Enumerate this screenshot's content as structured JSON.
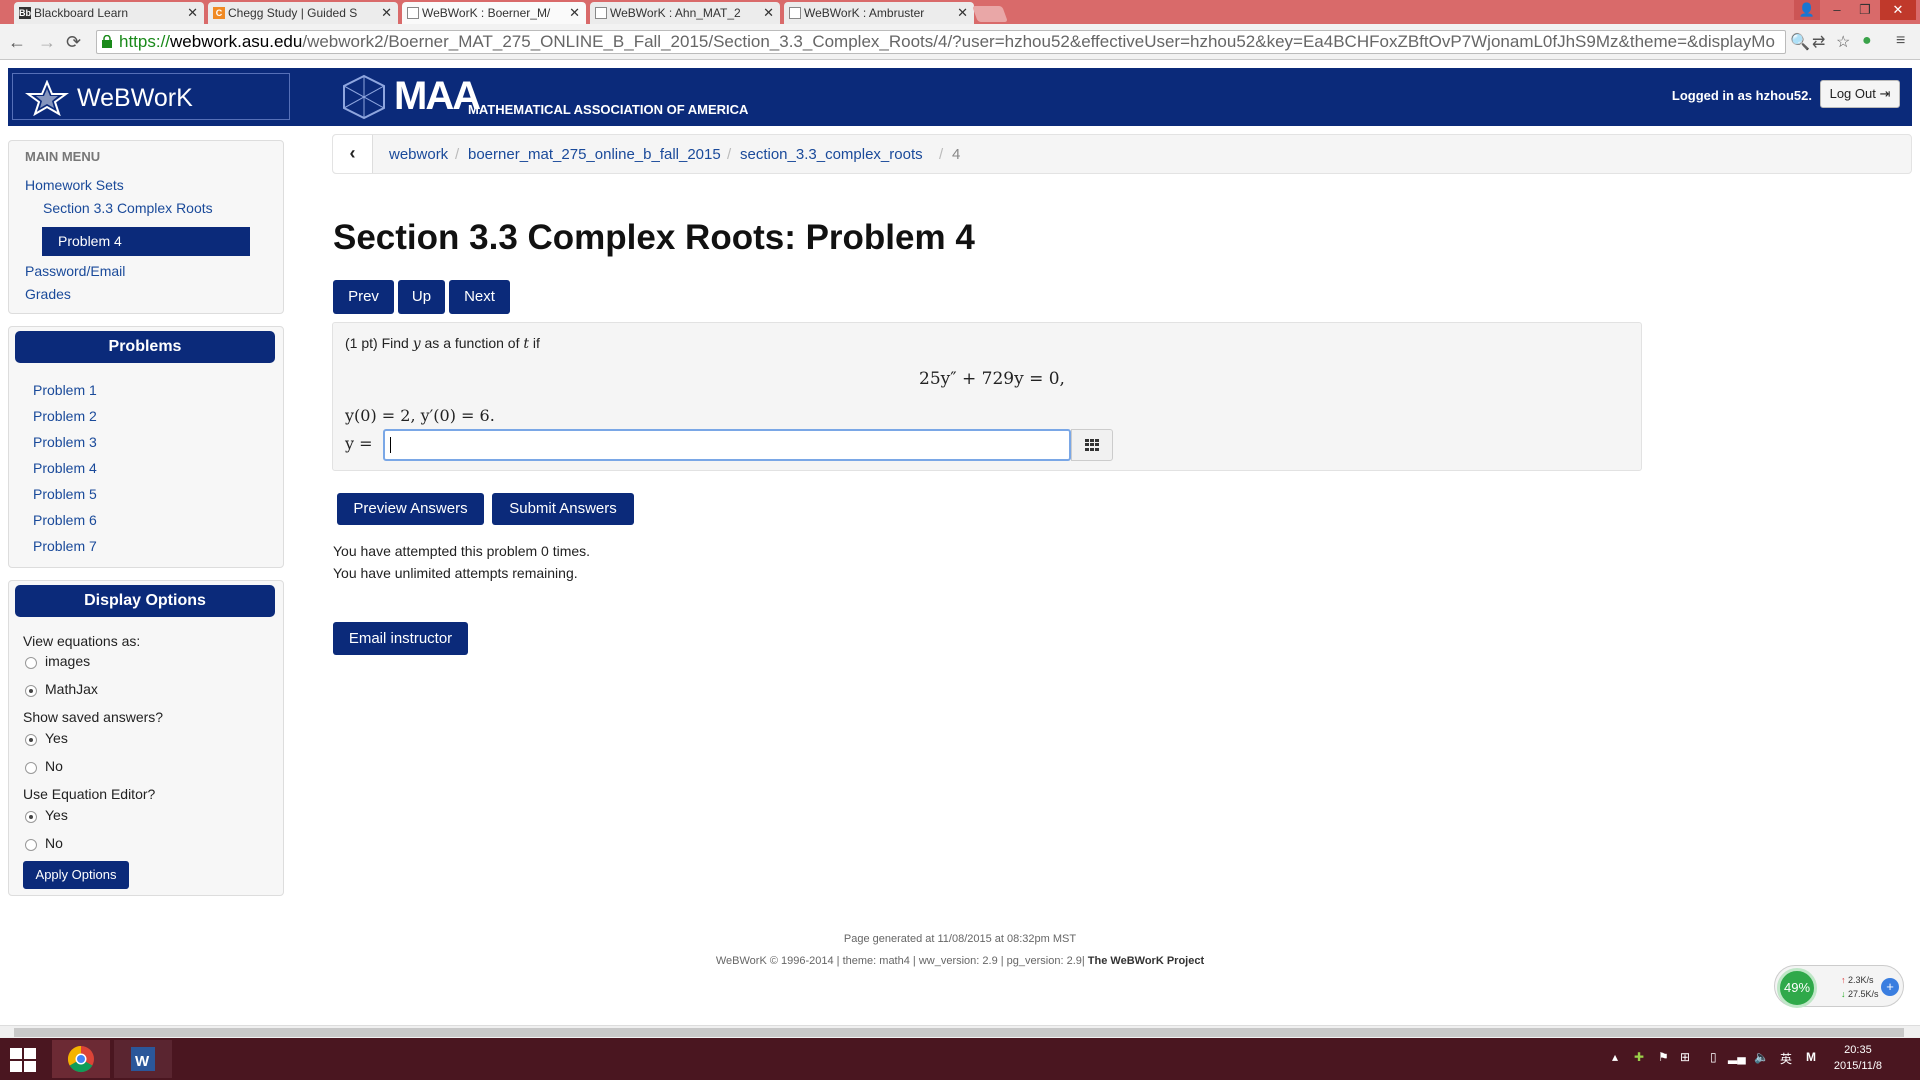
{
  "browser": {
    "tabs": [
      {
        "label": "Blackboard Learn",
        "favicon": "Bb",
        "active": false
      },
      {
        "label": "Chegg Study | Guided S",
        "favicon": "C",
        "active": false
      },
      {
        "label": "WeBWorK : Boerner_M/",
        "favicon": "doc",
        "active": true
      },
      {
        "label": "WeBWorK : Ahn_MAT_2",
        "favicon": "doc",
        "active": false
      },
      {
        "label": "WeBWorK : Ambruster",
        "favicon": "doc",
        "active": false
      }
    ],
    "url": {
      "scheme": "https://",
      "host": "webwork.asu.edu",
      "path": "/webwork2/Boerner_MAT_275_ONLINE_B_Fall_2015/Section_3.3_Complex_Roots/4/?user=hzhou52&effectiveUser=hzhou52&key=Ea4BCHFoxZBftOvP7WjonamL0fJhS9Mz&theme=&displayMo"
    }
  },
  "header": {
    "app_name": "WeBWorK",
    "maa_logo": "MAA",
    "maa_sub": "MATHEMATICAL ASSOCIATION OF AMERICA",
    "logged_in": "Logged in as hzhou52.",
    "logout_label": "Log Out"
  },
  "sidebar": {
    "menu_heading": "MAIN MENU",
    "menu_items": [
      "Homework Sets",
      "Section 3.3 Complex Roots",
      "Problem 4",
      "Password/Email",
      "Grades"
    ],
    "problems_heading": "Problems",
    "problems": [
      "Problem 1",
      "Problem 2",
      "Problem 3",
      "Problem 4",
      "Problem 5",
      "Problem 6",
      "Problem 7"
    ],
    "display_heading": "Display Options",
    "view_eq_label": "View equations as:",
    "view_eq_options": [
      "images",
      "MathJax"
    ],
    "view_eq_selected": "MathJax",
    "show_saved_label": "Show saved answers?",
    "show_saved_options": [
      "Yes",
      "No"
    ],
    "show_saved_selected": "Yes",
    "eq_editor_label": "Use Equation Editor?",
    "eq_editor_options": [
      "Yes",
      "No"
    ],
    "eq_editor_selected": "Yes",
    "apply_label": "Apply Options"
  },
  "breadcrumb": [
    "webwork",
    "boerner_mat_275_online_b_fall_2015",
    "section_3.3_complex_roots",
    "4"
  ],
  "main": {
    "title": "Section 3.3 Complex Roots: Problem 4",
    "nav": [
      "Prev",
      "Up",
      "Next"
    ],
    "problem": {
      "intro_pts": "(1 pt) Find",
      "intro_var1": "y",
      "intro_mid": "as a function of",
      "intro_var2": "t",
      "intro_end": "if",
      "equation": "25y″ + 729y = 0,",
      "initial_conditions": "y(0) = 2,    y′(0) = 6.",
      "answer_label": "y =",
      "answer_value": ""
    },
    "preview_label": "Preview Answers",
    "submit_label": "Submit Answers",
    "attempted_text": "You have attempted this problem 0 times.",
    "remaining_text": "You have unlimited attempts remaining.",
    "email_label": "Email instructor"
  },
  "footer": {
    "generated": "Page generated at 11/08/2015 at 08:32pm MST",
    "credits": "WeBWorK © 1996-2014 | theme: math4 | ww_version: 2.9 | pg_version: 2.9|",
    "project": "The WeBWorK Project"
  },
  "net_widget": {
    "percent": "49%",
    "up_speed": "2.3K/s",
    "down_speed": "27.5K/s"
  },
  "taskbar": {
    "ime": "英",
    "time": "20:35",
    "date": "2015/11/8"
  },
  "colors": {
    "brand_blue": "#0b2a7a",
    "link_blue": "#1a4a9a",
    "tab_strip": "#d96a6a",
    "taskbar": "#4a1620"
  }
}
